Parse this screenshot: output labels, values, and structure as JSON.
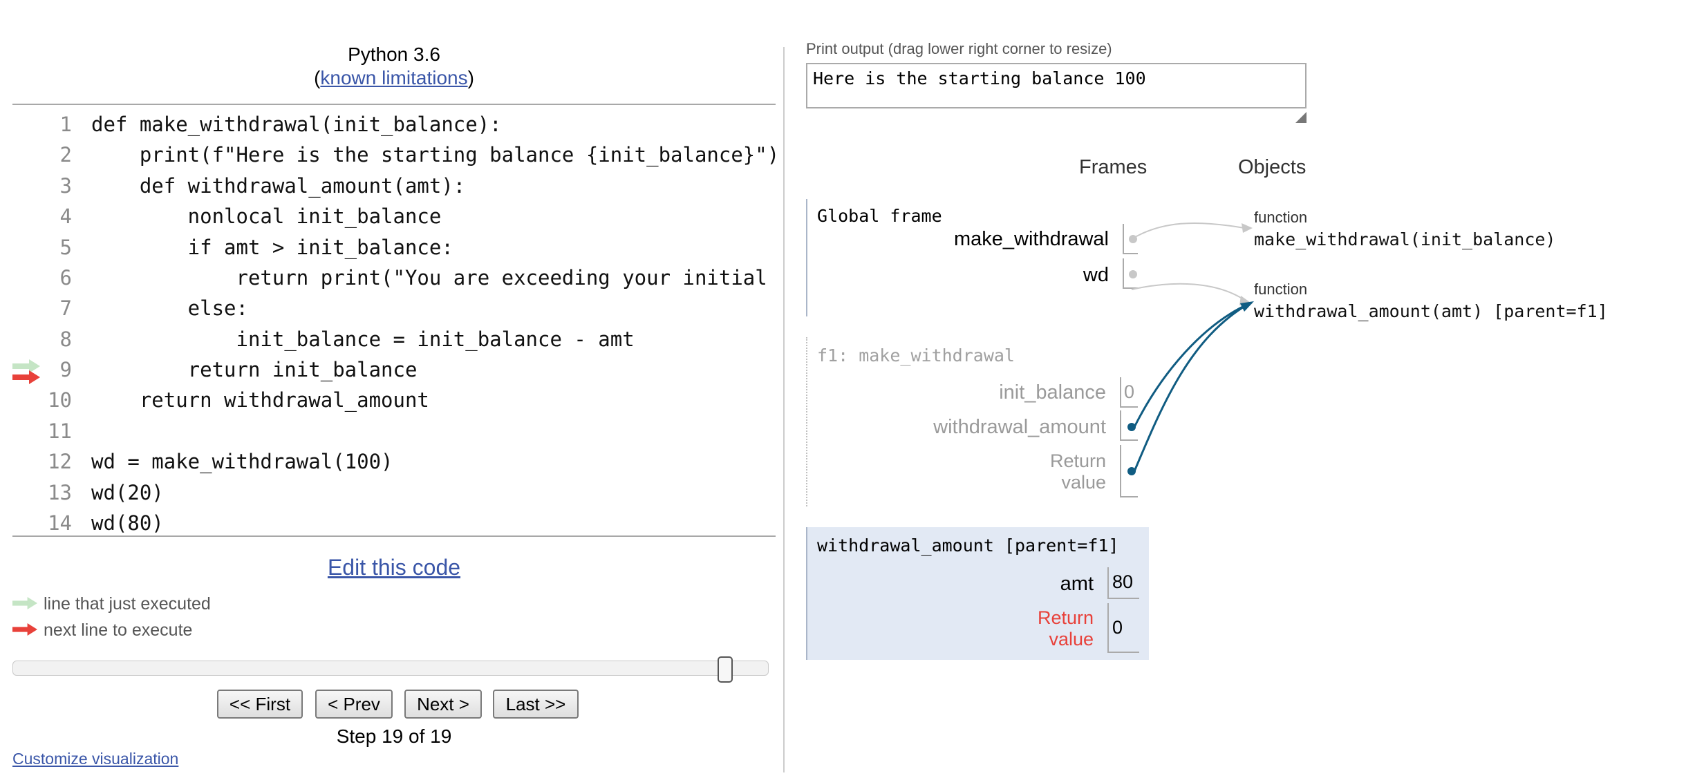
{
  "header": {
    "language": "Python 3.6",
    "open_paren": "(",
    "limitations_link": "known limitations",
    "close_paren": ")"
  },
  "code": {
    "lines": [
      {
        "n": "1",
        "text": "def make_withdrawal(init_balance):"
      },
      {
        "n": "2",
        "text": "    print(f\"Here is the starting balance {init_balance}\")"
      },
      {
        "n": "3",
        "text": "    def withdrawal_amount(amt):"
      },
      {
        "n": "4",
        "text": "        nonlocal init_balance"
      },
      {
        "n": "5",
        "text": "        if amt > init_balance:"
      },
      {
        "n": "6",
        "text": "            return print(\"You are exceeding your initial"
      },
      {
        "n": "7",
        "text": "        else:"
      },
      {
        "n": "8",
        "text": "            init_balance = init_balance - amt"
      },
      {
        "n": "9",
        "text": "        return init_balance"
      },
      {
        "n": "10",
        "text": "    return withdrawal_amount"
      },
      {
        "n": "11",
        "text": ""
      },
      {
        "n": "12",
        "text": "wd = make_withdrawal(100)"
      },
      {
        "n": "13",
        "text": "wd(20)"
      },
      {
        "n": "14",
        "text": "wd(80)"
      }
    ],
    "executed_line": 9,
    "next_line": 9
  },
  "edit_link": "Edit this code",
  "legend": {
    "executed": "line that just executed",
    "next": "next line to execute"
  },
  "navigation": {
    "first": "<< First",
    "prev": "< Prev",
    "next": "Next >",
    "last": "Last >>",
    "step_label": "Step 19 of 19",
    "slider_position": 1.0
  },
  "customize_link": "Customize visualization",
  "print_output": {
    "label": "Print output (drag lower right corner to resize)",
    "text": "Here is the starting balance 100"
  },
  "visualization": {
    "frames_header": "Frames",
    "objects_header": "Objects",
    "global_frame": {
      "title": "Global frame",
      "vars": [
        {
          "name": "make_withdrawal"
        },
        {
          "name": "wd"
        }
      ]
    },
    "f1_frame": {
      "title": "f1: make_withdrawal",
      "vars": [
        {
          "name": "init_balance",
          "value": "0"
        },
        {
          "name": "withdrawal_amount"
        },
        {
          "name": "Return value"
        }
      ]
    },
    "active_frame": {
      "title": "withdrawal_amount [parent=f1]",
      "vars": [
        {
          "name": "amt",
          "value": "80"
        },
        {
          "name": "Return value",
          "value": "0"
        }
      ]
    },
    "objects": [
      {
        "type": "function",
        "name": "make_withdrawal(init_balance)"
      },
      {
        "type": "function",
        "name": "withdrawal_amount(amt) [parent=f1]"
      }
    ]
  },
  "colors": {
    "executed_arrow": "#c5e5c5",
    "next_arrow": "#e8413a",
    "pointer_active": "#105c82",
    "pointer_inactive": "#c8c8c8",
    "return_value_label": "#e8413a",
    "active_frame_bg": "#e2e9f4"
  }
}
